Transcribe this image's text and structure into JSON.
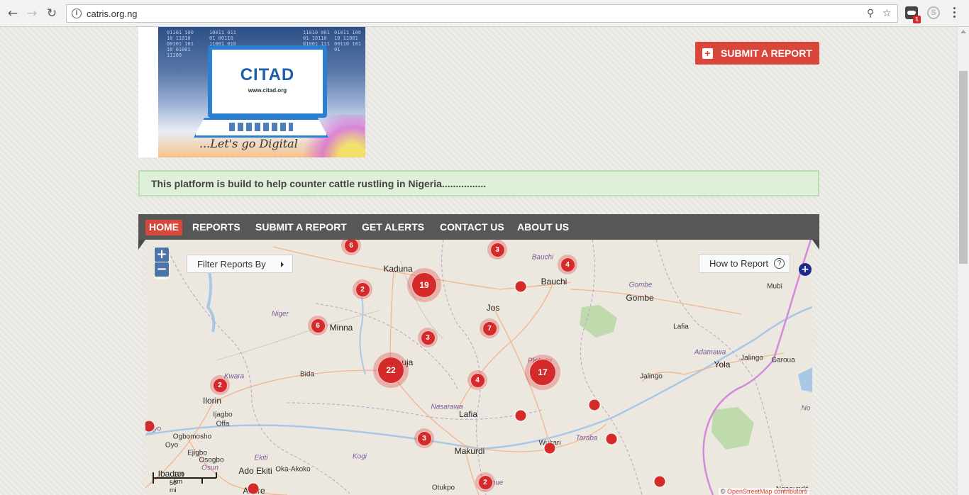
{
  "browser": {
    "url": "catris.org.ng",
    "extension_badge": "1",
    "extension_2_letter": "S"
  },
  "banner": {
    "logo_text": "CITAD",
    "logo_url": "www.citad.org",
    "tagline": "...Let's go Digital"
  },
  "header": {
    "submit_button_label": "SUBMIT A REPORT"
  },
  "notice": {
    "text": "This platform is build to help counter cattle rustling in Nigeria................"
  },
  "nav": {
    "items": [
      {
        "label": "HOME",
        "active": true
      },
      {
        "label": "REPORTS",
        "active": false
      },
      {
        "label": "SUBMIT A REPORT",
        "active": false
      },
      {
        "label": "GET ALERTS",
        "active": false
      },
      {
        "label": "CONTACT US",
        "active": false
      },
      {
        "label": "ABOUT US",
        "active": false
      }
    ]
  },
  "map": {
    "zoom_in": "+",
    "zoom_out": "−",
    "filter_label": "Filter Reports By",
    "how_to_label": "How to Report",
    "how_to_icon": "?",
    "layer_toggle": "+",
    "scale_km": "100 km",
    "scale_mi": "50 mi",
    "attribution_prefix": "©",
    "attribution_link": "OpenStreetMap contributors",
    "cities": [
      {
        "name": "Kaduna"
      },
      {
        "name": "Bauchi"
      },
      {
        "name": "Gombe"
      },
      {
        "name": "Jos"
      },
      {
        "name": "Minna"
      },
      {
        "name": "Abuja"
      },
      {
        "name": "Ilorin"
      },
      {
        "name": "Lafia"
      },
      {
        "name": "Makurdi"
      },
      {
        "name": "Yola"
      },
      {
        "name": "Jalingo"
      },
      {
        "name": "Wukari"
      },
      {
        "name": "Akure"
      },
      {
        "name": "Ado Ekiti"
      },
      {
        "name": "Ibadan"
      },
      {
        "name": "Bida"
      },
      {
        "name": "Ijagbo"
      },
      {
        "name": "Offa"
      },
      {
        "name": "Ogbomosho"
      },
      {
        "name": "Oyo"
      },
      {
        "name": "Ejigbo"
      },
      {
        "name": "Osogbo"
      },
      {
        "name": "Oka-Akoko"
      },
      {
        "name": "Otukpo"
      },
      {
        "name": "Mubi"
      },
      {
        "name": "Garoua"
      },
      {
        "name": "Jalingo"
      },
      {
        "name": "Ngaoundé"
      },
      {
        "name": "Lafia"
      }
    ],
    "states": [
      {
        "name": "Bauchi"
      },
      {
        "name": "Gombe"
      },
      {
        "name": "Niger"
      },
      {
        "name": "Kwara"
      },
      {
        "name": "Plateau"
      },
      {
        "name": "Nasarawa"
      },
      {
        "name": "Adamawa"
      },
      {
        "name": "Taraba"
      },
      {
        "name": "Kogi"
      },
      {
        "name": "Ekiti"
      },
      {
        "name": "Osun"
      },
      {
        "name": "Benue"
      },
      {
        "name": "Oyo"
      },
      {
        "name": "No"
      }
    ],
    "clusters": [
      {
        "count": "6"
      },
      {
        "count": "3"
      },
      {
        "count": "4"
      },
      {
        "count": "19"
      },
      {
        "count": "2"
      },
      {
        "count": "6"
      },
      {
        "count": "7"
      },
      {
        "count": "3"
      },
      {
        "count": "22"
      },
      {
        "count": "4"
      },
      {
        "count": "17"
      },
      {
        "count": "2"
      },
      {
        "count": "3"
      },
      {
        "count": "2"
      }
    ],
    "marker_color": "#d42a2a"
  },
  "colors": {
    "accent_red": "#d9463a",
    "nav_bg": "#575757",
    "notice_bg": "#dff0d8",
    "zoom_blue": "#4d74a8"
  }
}
